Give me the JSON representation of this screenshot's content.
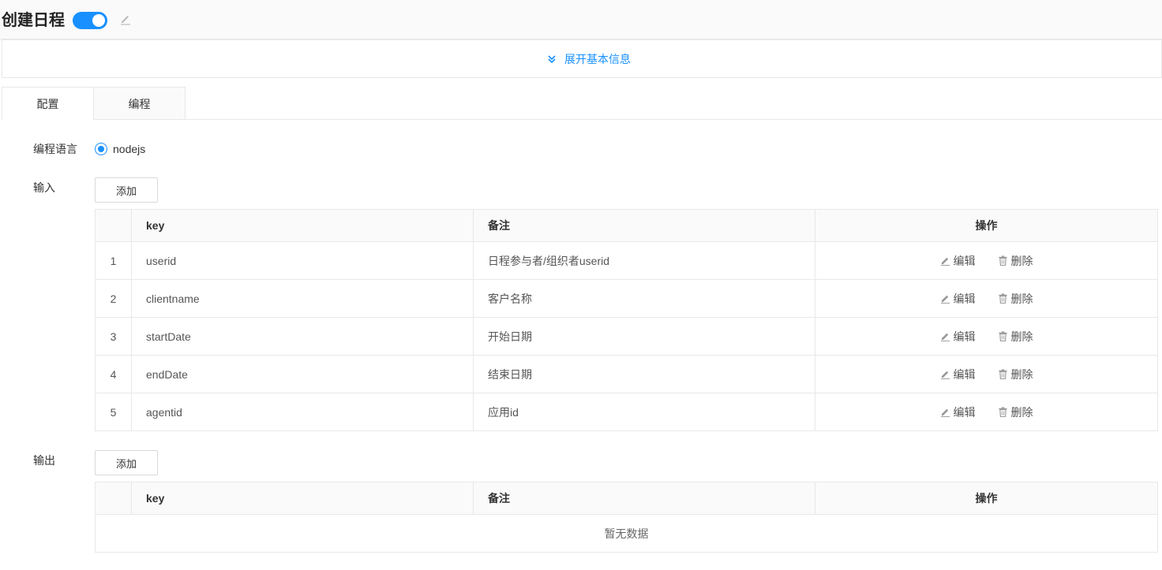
{
  "header": {
    "title": "创建日程",
    "toggle_on": true
  },
  "expand": {
    "label": "展开基本信息"
  },
  "tabs": [
    {
      "label": "配置"
    },
    {
      "label": "编程"
    }
  ],
  "config": {
    "language_label": "编程语言",
    "language_option": "nodejs",
    "input_label": "输入",
    "output_label": "输出",
    "add_label": "添加"
  },
  "table": {
    "columns": {
      "key": "key",
      "note": "备注",
      "op": "操作"
    },
    "actions": {
      "edit": "编辑",
      "delete": "删除"
    },
    "input_rows": [
      {
        "index": "1",
        "key": "userid",
        "note": "日程参与者/组织者userid"
      },
      {
        "index": "2",
        "key": "clientname",
        "note": "客户名称"
      },
      {
        "index": "3",
        "key": "startDate",
        "note": "开始日期"
      },
      {
        "index": "4",
        "key": "endDate",
        "note": "结束日期"
      },
      {
        "index": "5",
        "key": "agentid",
        "note": "应用id"
      }
    ],
    "empty_text": "暂无数据"
  },
  "colors": {
    "accent": "#1890ff",
    "border": "#e8e8e8",
    "header_bg": "#fafafa"
  }
}
